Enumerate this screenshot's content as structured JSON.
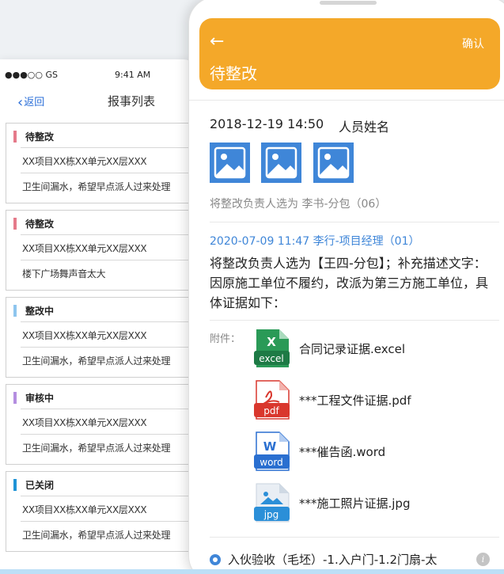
{
  "back_screen": {
    "status_bar": {
      "carrier": "●●●○○ GS",
      "time": "9:41 AM"
    },
    "nav": {
      "back_label": "返回",
      "title": "报事列表"
    },
    "items": [
      {
        "status": "待整改",
        "status_color": "#e57a8a",
        "location": "XX项目XX栋XX单元XX层XXX",
        "description": "卫生间漏水，希望早点派人过来处理"
      },
      {
        "status": "待整改",
        "status_color": "#e57a8a",
        "location": "XX项目XX栋XX单元XX层XXX",
        "description": "楼下广场舞声音太大"
      },
      {
        "status": "整改中",
        "status_color": "#8ec5ee",
        "location": "XX项目XX栋XX单元XX层XXX",
        "description": "卫生间漏水，希望早点派人过来处理"
      },
      {
        "status": "审核中",
        "status_color": "#b48ee0",
        "location": "XX项目XX栋XX单元XX层XXX",
        "description": "卫生间漏水，希望早点派人过来处理"
      },
      {
        "status": "已关闭",
        "status_color": "#1e93d6",
        "location": "XX项目XX栋XX单元XX层XXX",
        "description": "卫生间漏水，希望早点派人过来处理"
      }
    ]
  },
  "front_screen": {
    "header": {
      "back_icon": "arrow-left-icon",
      "confirm_label": "确认",
      "title": "待整改",
      "color": "#f4a829"
    },
    "entry1": {
      "datetime": "2018-12-19 14:50",
      "person": "人员姓名",
      "photo_icon": "image-icon",
      "photo_count": 3,
      "note": "将整改负责人选为 李书-分包（06）"
    },
    "entry2": {
      "meta": "2020-07-09 11:47    李行-项目经理（01）",
      "body": "将整改负责人选为【王四-分包】；补充描述文字：因原施工单位不履约，改派为第三方施工单位，具体证据如下：",
      "attachments_label": "附件：",
      "attachments": [
        {
          "type": "excel",
          "icon_label": "excel",
          "icon_letter": "X",
          "color": "#1d7a45",
          "name": "合同记录证据.excel"
        },
        {
          "type": "pdf",
          "icon_label": "pdf",
          "icon_letter": "",
          "color": "#d9372d",
          "name": "***工程文件证据.pdf"
        },
        {
          "type": "word",
          "icon_label": "word",
          "icon_letter": "W",
          "color": "#2a6fd0",
          "name": "***催告函.word"
        },
        {
          "type": "jpg",
          "icon_label": "jpg",
          "icon_letter": "",
          "color": "#2b8fd8",
          "name": "***施工照片证据.jpg"
        }
      ]
    },
    "progress": {
      "step": "入伙验收（毛坯）-1.入户门-1.2门扇-太",
      "info_icon": "info-icon"
    }
  }
}
